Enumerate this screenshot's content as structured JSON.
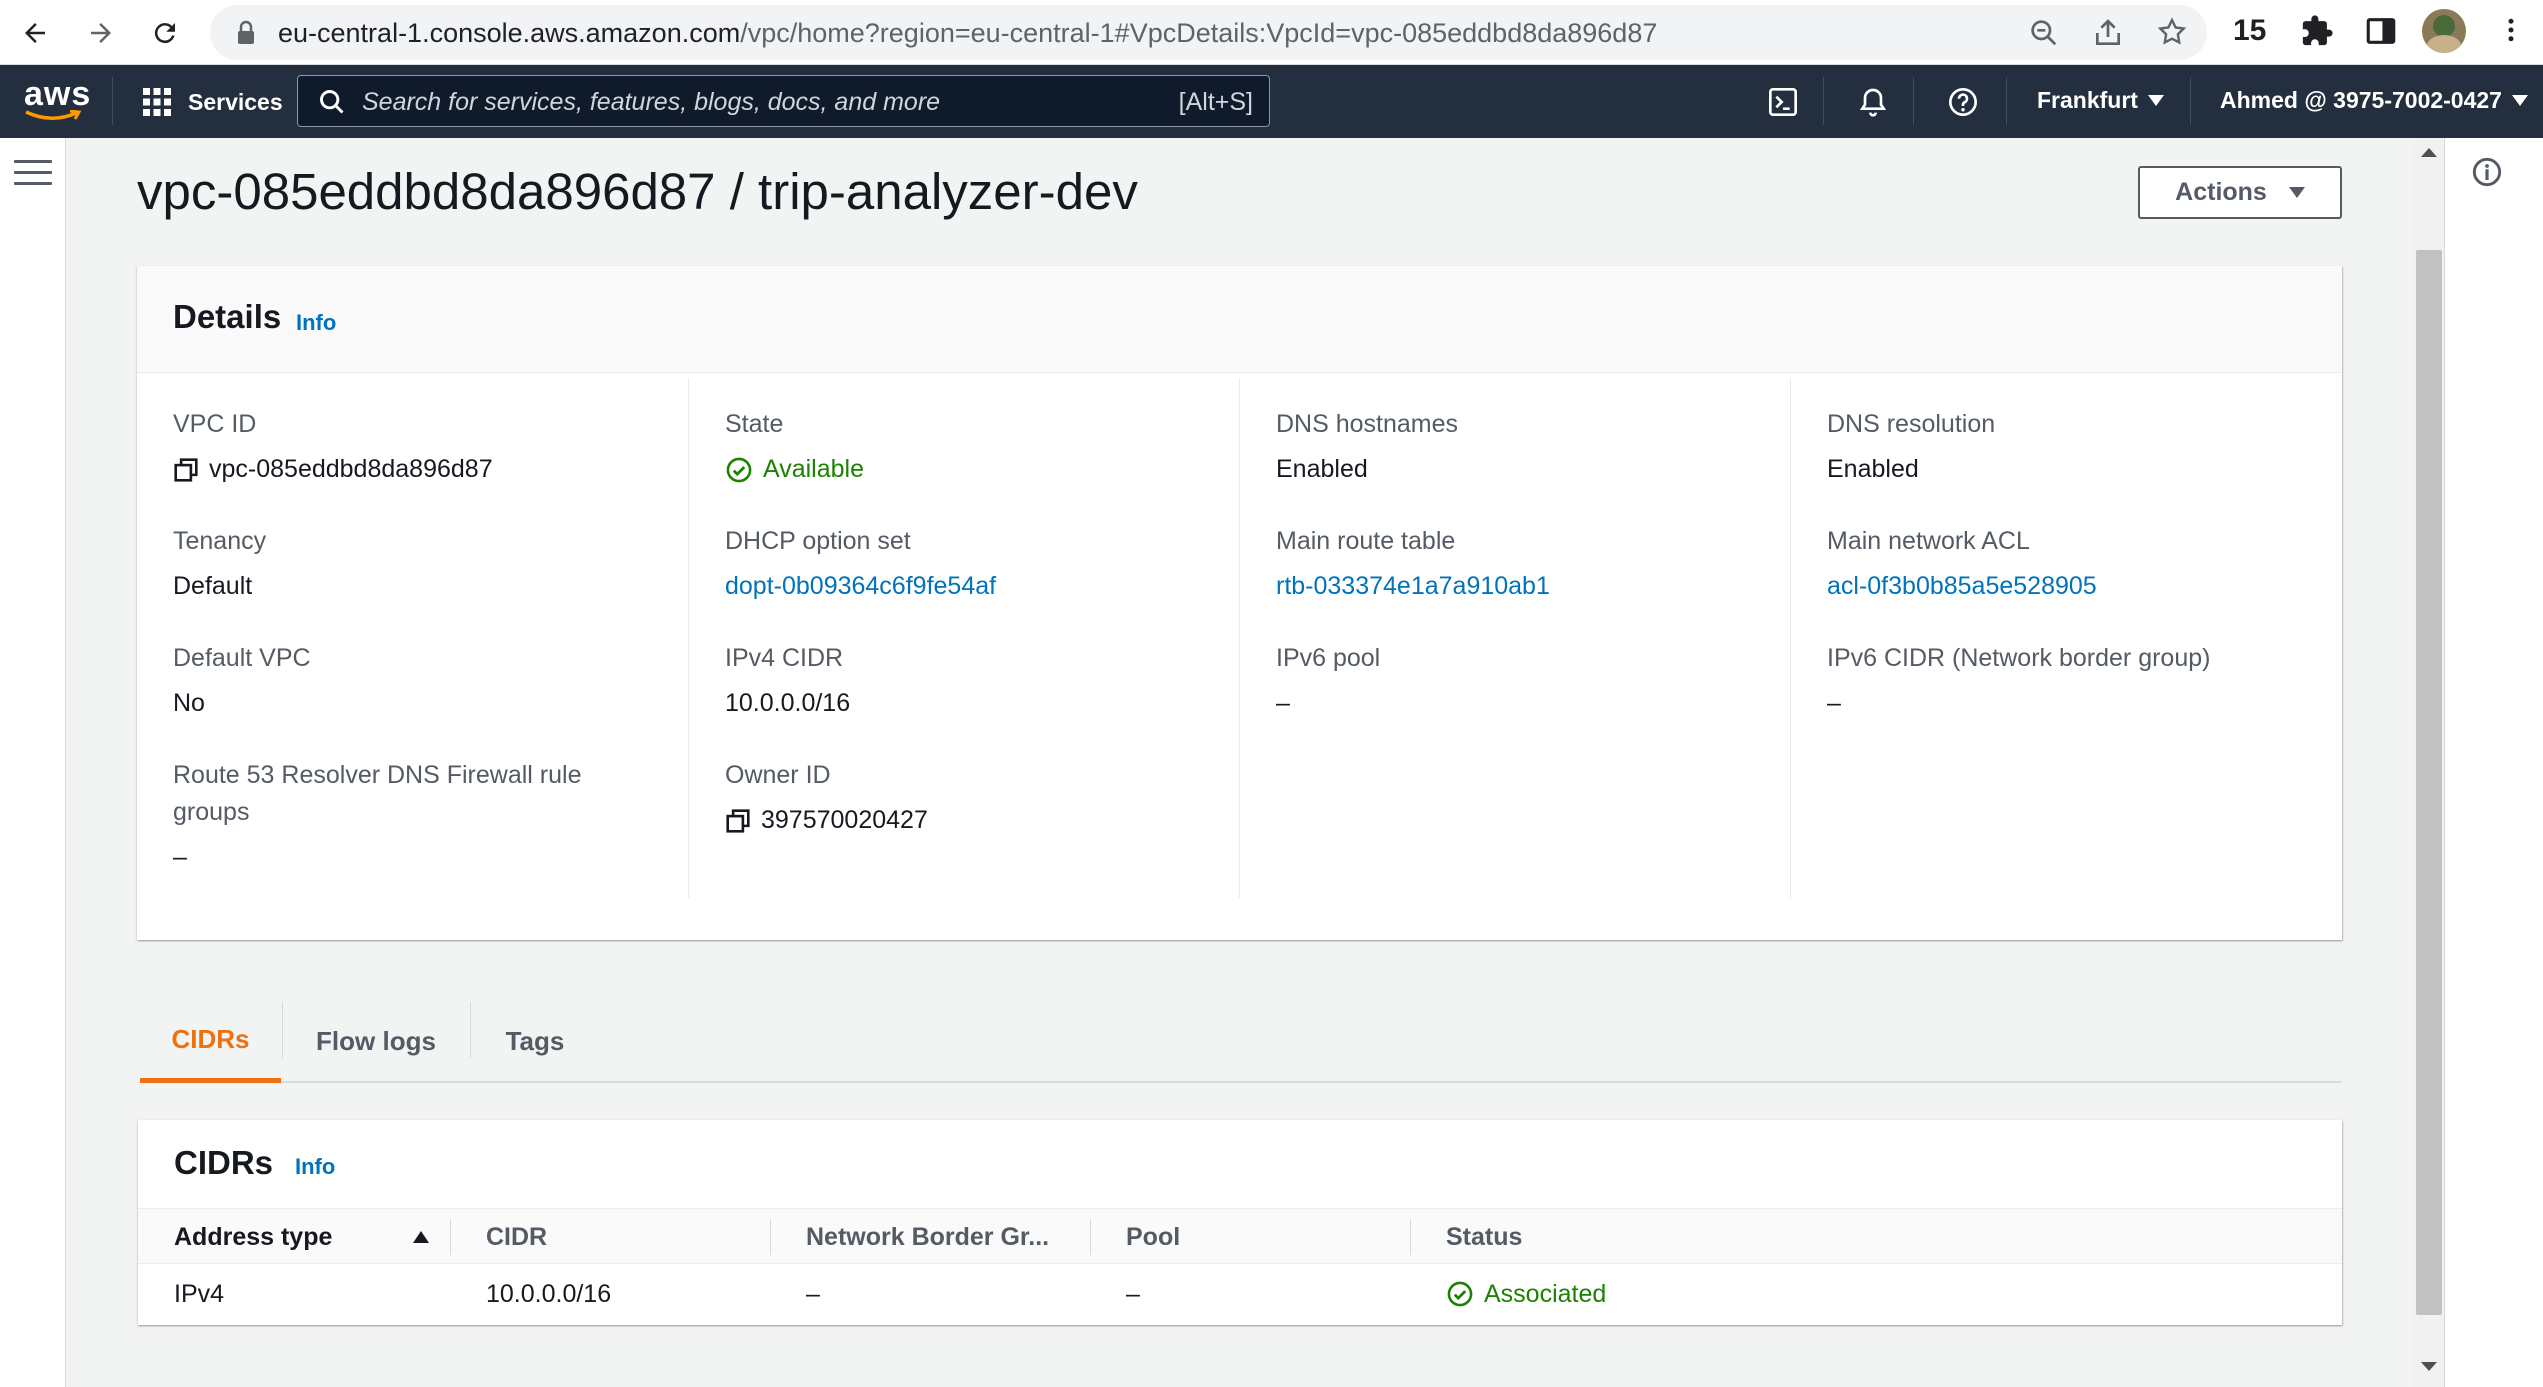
{
  "browser": {
    "url_host": "eu-central-1.console.aws.amazon.com",
    "url_path": "/vpc/home?region=eu-central-1#VpcDetails:VpcId=vpc-085eddbd8da896d87",
    "extension_count": "15"
  },
  "aws_nav": {
    "logo_text": "aws",
    "services_label": "Services",
    "search_placeholder": "Search for services, features, blogs, docs, and more",
    "search_shortcut": "[Alt+S]",
    "region": "Frankfurt",
    "account": "Ahmed @ 3975-7002-0427"
  },
  "page": {
    "title": "vpc-085eddbd8da896d87 / trip-analyzer-dev",
    "actions_label": "Actions"
  },
  "details": {
    "title": "Details",
    "info_label": "Info",
    "columns": [
      [
        {
          "label": "VPC ID",
          "value": "vpc-085eddbd8da896d87"
        },
        {
          "label": "Tenancy",
          "value": "Default"
        },
        {
          "label": "Default VPC",
          "value": "No"
        },
        {
          "label": "Route 53 Resolver DNS Firewall rule groups",
          "value": "–"
        }
      ],
      [
        {
          "label": "State",
          "value": "Available"
        },
        {
          "label": "DHCP option set",
          "value": "dopt-0b09364c6f9fe54af"
        },
        {
          "label": "IPv4 CIDR",
          "value": "10.0.0.0/16"
        },
        {
          "label": "Owner ID",
          "value": "397570020427"
        }
      ],
      [
        {
          "label": "DNS hostnames",
          "value": "Enabled"
        },
        {
          "label": "Main route table",
          "value": "rtb-033374e1a7a910ab1"
        },
        {
          "label": "IPv6 pool",
          "value": "–"
        }
      ],
      [
        {
          "label": "DNS resolution",
          "value": "Enabled"
        },
        {
          "label": "Main network ACL",
          "value": "acl-0f3b0b85a5e528905"
        },
        {
          "label": "IPv6 CIDR (Network border group)",
          "value": "–"
        }
      ]
    ]
  },
  "tabs": [
    {
      "label": "CIDRs"
    },
    {
      "label": "Flow logs"
    },
    {
      "label": "Tags"
    }
  ],
  "cidrs_table": {
    "title": "CIDRs",
    "info_label": "Info",
    "columns": [
      "Address type",
      "CIDR",
      "Network Border Gr...",
      "Pool",
      "Status"
    ],
    "rows": [
      [
        "IPv4",
        "10.0.0.0/16",
        "–",
        "–",
        "Associated"
      ]
    ]
  },
  "colors": {
    "aws_nav_bg": "#232f3e",
    "link": "#0073bb",
    "success": "#1d8102",
    "active_tab": "#ec7211"
  }
}
